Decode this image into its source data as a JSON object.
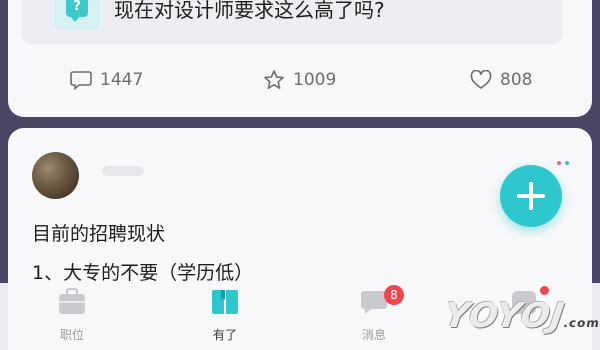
{
  "question_card": {
    "icon": "question-bubble-icon",
    "icon_glyph": "?",
    "title": "现在对设计师要求这么高了吗?",
    "stats": {
      "comments": "1447",
      "stars": "1009",
      "likes": "808"
    }
  },
  "post": {
    "line1": "目前的招聘现状",
    "line2": "1、大专的不要（学历低）"
  },
  "fab": {
    "icon": "plus-icon"
  },
  "bottom_nav": {
    "items": [
      {
        "label": "职位",
        "icon": "briefcase-icon",
        "active": false
      },
      {
        "label": "有了",
        "icon": "book-icon",
        "active": true
      },
      {
        "label": "消息",
        "icon": "chat-icon",
        "active": false,
        "badge": "8"
      },
      {
        "label": "",
        "icon": "profile-icon",
        "active": false
      }
    ]
  },
  "watermark": {
    "text": "YOYOJ",
    "suffix": ".com"
  },
  "colors": {
    "accent": "#2ec7cd",
    "badge": "#f0474e",
    "background": "#4b4566",
    "card": "#f8f8fa"
  }
}
